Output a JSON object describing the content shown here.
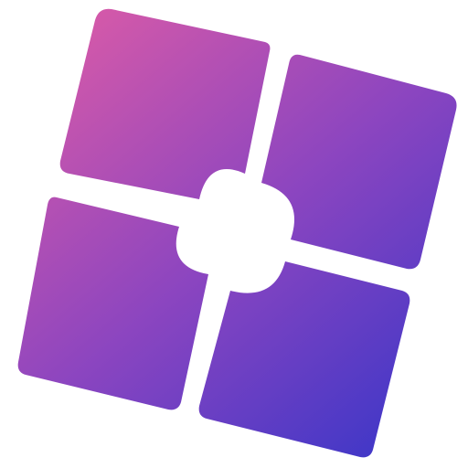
{
  "icon": {
    "name": "four-tile-window-logo",
    "tiles": [
      "top-left",
      "top-right",
      "bottom-left",
      "bottom-right"
    ],
    "colors": {
      "background": "#ffffff",
      "gradient_start": "#d85aa8",
      "gradient_mid": "#8b45c0",
      "gradient_end": "#3a36c8"
    }
  }
}
